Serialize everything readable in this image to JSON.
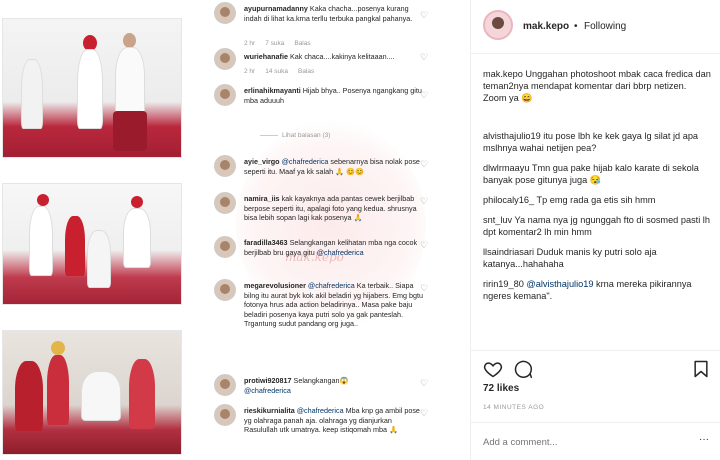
{
  "post": {
    "username": "mak.kepo",
    "follow_label": "Following",
    "caption_user": "mak.kepo",
    "caption_text": "Unggahan photoshoot mbak caca fredica dan teman2nya mendapat komentar dari bbrp netizen.",
    "caption_zoom": "Zoom ya 😄",
    "likes": "72 likes",
    "time": "14 MINUTES AGO",
    "add_comment_placeholder": "Add a comment...",
    "more": "···"
  },
  "post_comments": [
    {
      "user": "alvisthajulio19",
      "text": "itu pose lbh ke kek gaya lg silat jd apa mslhnya wahai netijen pea?"
    },
    {
      "user": "dlwlrmaayu",
      "text": "Tmn gua pake hijab kalo karate di sekola banyak pose gitunya juga 😪"
    },
    {
      "user": "philocaly16_",
      "text": "Tp emg rada ga etis sih hmm"
    },
    {
      "user": "snt_luv",
      "text": "Ya nama nya jg ngunggah fto di sosmed pasti lh dpt komentar2 lh min hmm"
    },
    {
      "user": "llsaindriasari",
      "text": "Duduk manis ky putri solo aja katanya...hahahaha"
    },
    {
      "user": "ririn19_80",
      "mention": "@alvisthajulio19",
      "text": "krna mereka pikirannya ngeres kemana\"."
    }
  ],
  "screenshot_comments": [
    {
      "user": "ayupurnamadanny",
      "text": "Kaka chacha...posenya kurang indah di lihat ka.krna terllu terbuka pangkal pahanya.",
      "time": "2 hr",
      "likes": "7 suka",
      "reply": "Balas"
    },
    {
      "user": "wuriehanafie",
      "text": "Kak chaca....kakinya kelitaaan....",
      "time": "2 hr",
      "likes": "14 suka",
      "reply": "Balas"
    },
    {
      "user": "erlinahikmayanti",
      "text": "Hijab bhya.. Posenya ngangkang gitu mba aduuuh",
      "time": "",
      "likes": "",
      "reply": ""
    },
    {
      "user": "ayie_virgo",
      "mention": "@chafrederica",
      "text": "sebenarnya bisa nolak pose seperti itu. Maaf ya kk salah 🙏 😊😊",
      "time": "",
      "likes": "",
      "reply": ""
    },
    {
      "user": "namira_iis",
      "text": "kak kayaknya ada pantas cewek berjilbab berpose seperti itu, apalagi foto yang kedua. shrusnya bisa lebih sopan lagi kak posenya 🙏",
      "time": "",
      "likes": "",
      "reply": ""
    },
    {
      "user": "faradilla3463",
      "mention": "@chafrederica",
      "text": "Selangkangan kelihatan mba nga cocok berjilbab bru gaya gitu",
      "time": "",
      "likes": "",
      "reply": ""
    },
    {
      "user": "megarevolusioner",
      "mention": "@chafrederica",
      "text": "Ka terbaik.. Siapa bilng itu aurat byk kok akil beladiri yg hijabers. Emg bgtu fotonya hrus ada action beladirinya.. Masa pake baju beladiri posenya kaya putri solo ya gak panteslah. Trgantung sudut pandang org juga..",
      "time": "",
      "likes": "",
      "reply": ""
    },
    {
      "user": "protiwi920817",
      "mention": "@chafrederica",
      "text": "Selangkangan😱",
      "time": "",
      "likes": "",
      "reply": ""
    },
    {
      "user": "rieskikurnialita",
      "mention": "@chafrederica",
      "text": "Mba knp ga ambil pose yg olahraga panah aja. olahraga yg dianjurkan Rasulullah utk umatnya. keep istiqomah mba 🙏",
      "time": "",
      "likes": "",
      "reply": ""
    }
  ],
  "replies_label": "Lihat balasan (3)",
  "watermark": "mak.kepo",
  "icons": {
    "heart": "heart-icon",
    "comment": "comment-icon",
    "bookmark": "bookmark-icon"
  }
}
